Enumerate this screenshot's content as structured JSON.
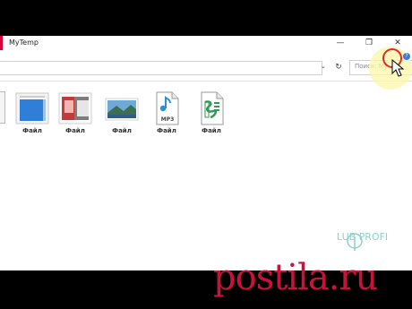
{
  "window": {
    "title": "MyTemp",
    "min_glyph": "—",
    "max_glyph": "❐",
    "close_glyph": "✕"
  },
  "address": {
    "dropdown_glyph": "⌄",
    "refresh_glyph": "↻"
  },
  "search": {
    "placeholder": "Поиск: My"
  },
  "files": [
    {
      "label": "Файл",
      "icon": "document-thumbnail"
    },
    {
      "label": "Файл",
      "icon": "image-thumbnail"
    },
    {
      "label": "Файл",
      "icon": "landscape-thumbnail"
    },
    {
      "label": "Файл",
      "icon": "mp3-audio-icon"
    },
    {
      "label": "Файл",
      "icon": "audio-file-icon"
    }
  ],
  "mp3_text": "MP3",
  "help_glyph": "?",
  "watermark": "LUB PROFI",
  "brand": "postila.ru",
  "colors": {
    "brand_red": "#c9123a",
    "watermark_teal": "#8fd1c9",
    "ring_red": "#e32a2a"
  }
}
